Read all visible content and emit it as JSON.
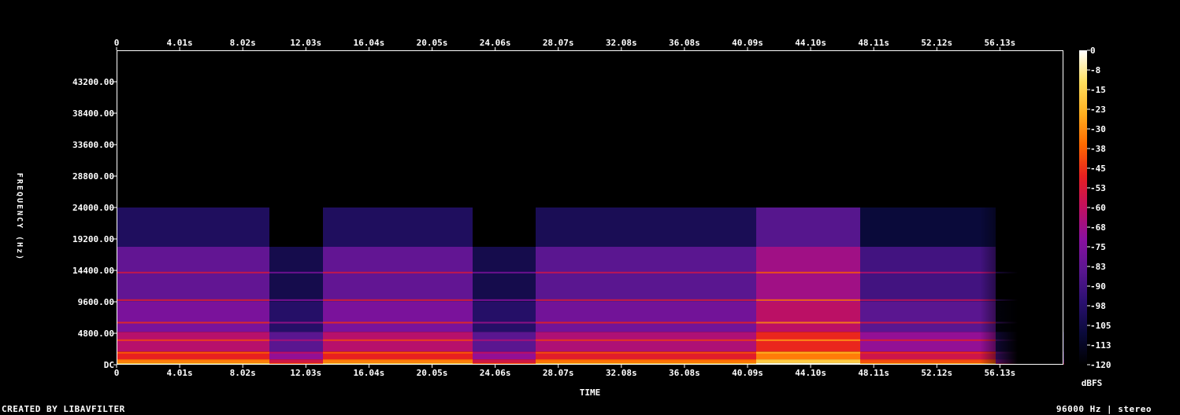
{
  "chart_data": {
    "type": "heatmap",
    "title": "",
    "xlabel": "TIME",
    "ylabel": "FREQUENCY (Hz)",
    "colorbar_label": "dBFS",
    "x_ticks": [
      "0",
      "4.01s",
      "8.02s",
      "12.03s",
      "16.04s",
      "20.05s",
      "24.06s",
      "28.07s",
      "32.08s",
      "36.08s",
      "40.09s",
      "44.10s",
      "48.11s",
      "52.12s",
      "56.13s"
    ],
    "y_ticks": [
      "DC",
      "4800.00",
      "9600.00",
      "14400.00",
      "19200.00",
      "24000.00",
      "28800.00",
      "33600.00",
      "38400.00",
      "43200.00"
    ],
    "colorbar_ticks": [
      "0",
      "-8",
      "-15",
      "-23",
      "-30",
      "-38",
      "-45",
      "-53",
      "-60",
      "-68",
      "-75",
      "-83",
      "-90",
      "-98",
      "-105",
      "-113",
      "-120"
    ],
    "xlim": [
      0,
      60.1
    ],
    "ylim": [
      0,
      48000
    ],
    "zlim": [
      -120,
      0
    ],
    "colormap": [
      "#000000",
      "#0a0a3a",
      "#2a1070",
      "#5a1690",
      "#8a10a0",
      "#c01060",
      "#e82020",
      "#ff6a00",
      "#ffb020",
      "#ffe060",
      "#ffffff"
    ],
    "sections": [
      {
        "start": 0.0,
        "end": 9.7,
        "level_db": -70
      },
      {
        "start": 9.7,
        "end": 13.1,
        "level_db": -92
      },
      {
        "start": 13.1,
        "end": 22.6,
        "level_db": -70
      },
      {
        "start": 22.6,
        "end": 26.6,
        "level_db": -92
      },
      {
        "start": 26.6,
        "end": 40.6,
        "level_db": -72
      },
      {
        "start": 40.6,
        "end": 47.2,
        "level_db": -55
      },
      {
        "start": 47.2,
        "end": 55.8,
        "level_db": -78
      },
      {
        "start": 55.8,
        "end": 60.1,
        "level_db": -110
      }
    ],
    "bandwidth_edges_hz": [
      18000,
      24000
    ]
  },
  "footer": {
    "left": "CREATED BY LIBAVFILTER",
    "right": "96000 Hz | stereo"
  }
}
